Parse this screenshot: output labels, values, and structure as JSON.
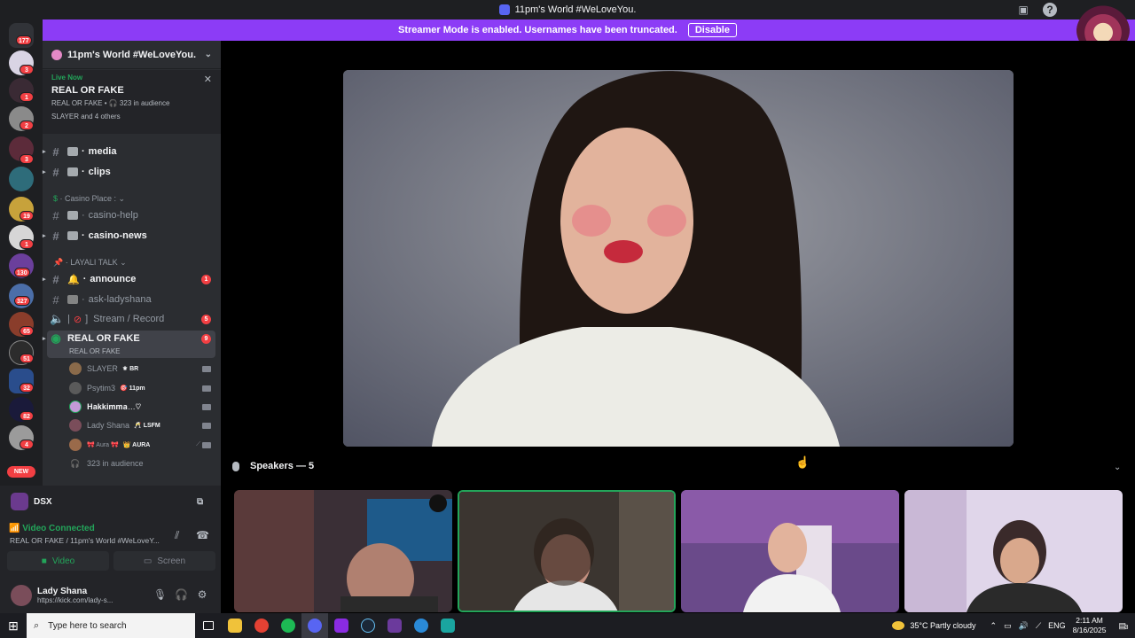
{
  "window": {
    "title": "11pm's World #WeLoveYou."
  },
  "banner": {
    "text": "Streamer Mode is enabled. Usernames have been truncated.",
    "button": "Disable"
  },
  "servers": {
    "home_badge": "177",
    "badges": [
      "3",
      "1",
      "2",
      "3",
      "",
      "19",
      "1",
      "130",
      "327",
      "65",
      "51",
      "32",
      "82",
      "4"
    ],
    "new_label": "NEW"
  },
  "guild": {
    "name": "11pm's World #WeLoveYou."
  },
  "live": {
    "status": "Live Now",
    "title": "REAL OR FAKE",
    "meta": "REAL OR FAKE • 🎧 323 in audience",
    "participants": "SLAYER and 4 others"
  },
  "channels": {
    "media": "media",
    "clips": "clips",
    "casino_cat": "Casino Place :",
    "casino_help": "casino-help",
    "casino_news": "casino-news",
    "layali_cat": "LAYALI TALK",
    "announce": "announce",
    "announce_badge": "1",
    "ask": "ask-ladyshana",
    "stream": "Stream / Record",
    "stream_badge": "5",
    "stage": "REAL OR FAKE",
    "stage_sub": "REAL OR FAKE",
    "stage_badge": "9"
  },
  "voice_users": [
    {
      "name": "SLAYER",
      "tag": "⚜ BR"
    },
    {
      "name": "Psytim3",
      "tag": "🎯 11pm"
    },
    {
      "name": "𝐇𝐚𝐤𝐤𝐢𝐦𝐦𝐚…♡",
      "tag": ""
    },
    {
      "name": "Lady Shana",
      "tag": "🥂 LSFM"
    },
    {
      "name": "🎀 Aura 🎀",
      "tag": "👑 AURA"
    }
  ],
  "audience": "323 in audience",
  "panel": {
    "server": "DSX",
    "status": "Video Connected",
    "substatus": "REAL OR FAKE / 11pm's World #WeLoveY...",
    "video_btn": "Video",
    "screen_btn": "Screen",
    "user_name": "Lady Shana",
    "user_status": "https://kick.com/lady-s..."
  },
  "stage": {
    "speakers_label": "Speakers — 5"
  },
  "taskbar": {
    "search_placeholder": "Type here to search",
    "weather": "35°C  Partly cloudy",
    "lang": "ENG",
    "time": "2:11 AM",
    "date": "8/16/2025",
    "notif": "3"
  },
  "colors": {
    "accent": "#8c3cf6",
    "online": "#23a55a",
    "alert": "#f23f43",
    "blurple": "#5865f2"
  }
}
